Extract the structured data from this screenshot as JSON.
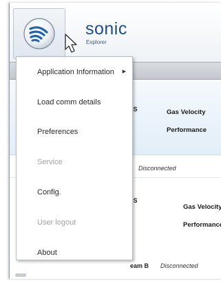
{
  "brand": {
    "name": "sonic",
    "subtitle": "Explorer"
  },
  "icons": {
    "logo": "sonic-logo-icon",
    "cursor": "mouse-cursor-icon",
    "submenu": "chevron-right-icon"
  },
  "menu": {
    "items": [
      {
        "label": "Application Information",
        "enabled": true,
        "submenu": true,
        "arrow": "▶"
      },
      {
        "label": "Load comm details",
        "enabled": true
      },
      {
        "label": "Preferences",
        "enabled": true
      },
      {
        "label": "Service",
        "enabled": false
      },
      {
        "label": "Config.",
        "enabled": true
      },
      {
        "label": "User logout",
        "enabled": false
      },
      {
        "label": "About",
        "enabled": true
      }
    ]
  },
  "meters": [
    {
      "status": "US",
      "labels": [
        "Gas Velocity",
        "Performance"
      ]
    },
    {
      "connection": "Disconnected"
    },
    {
      "status": "US",
      "labels": [
        "Gas Velocity",
        "Performance"
      ]
    },
    {
      "name": "eam B",
      "connection": "Disconnected"
    }
  ],
  "colors": {
    "brand": "#1d4f8c",
    "logo_blue": "#1e66b3",
    "selected_row": "#e2eef8",
    "disabled_text": "#a3a3a3"
  }
}
